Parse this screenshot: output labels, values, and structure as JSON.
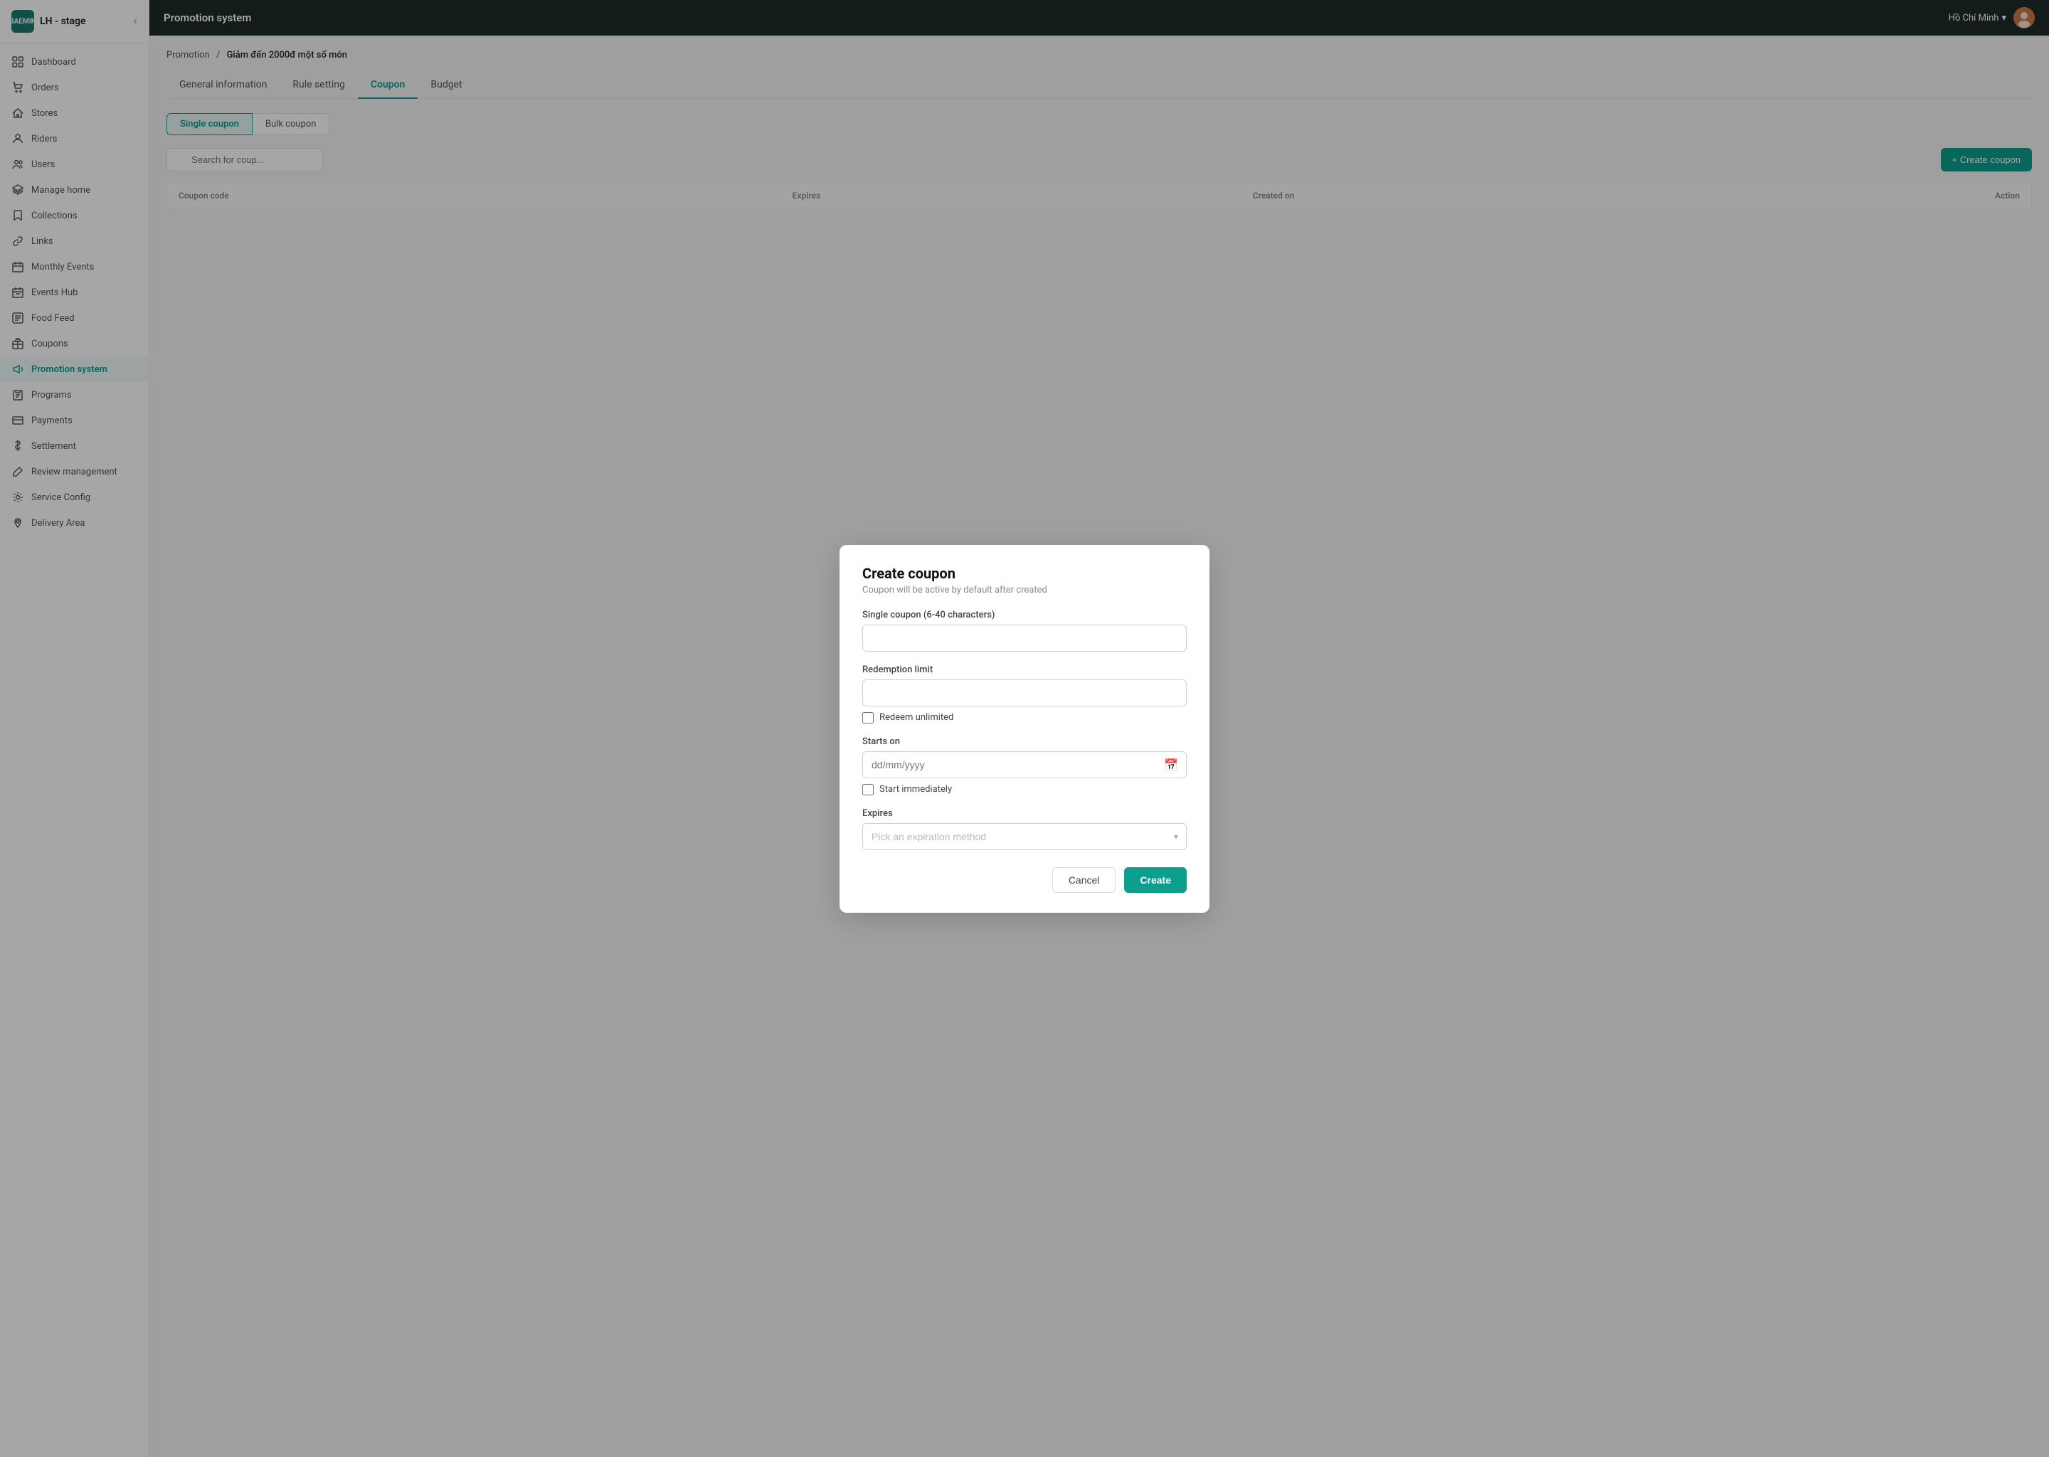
{
  "app": {
    "logo_line1": "BAE",
    "logo_line2": "MIN",
    "title": "LH - stage"
  },
  "topbar": {
    "title": "Promotion system",
    "location": "Hồ Chí Minh",
    "chevron": "▾"
  },
  "sidebar": {
    "items": [
      {
        "id": "dashboard",
        "label": "Dashboard",
        "icon": "grid"
      },
      {
        "id": "orders",
        "label": "Orders",
        "icon": "cart"
      },
      {
        "id": "stores",
        "label": "Stores",
        "icon": "home"
      },
      {
        "id": "riders",
        "label": "Riders",
        "icon": "person"
      },
      {
        "id": "users",
        "label": "Users",
        "icon": "users"
      },
      {
        "id": "manage-home",
        "label": "Manage home",
        "icon": "layers"
      },
      {
        "id": "collections",
        "label": "Collections",
        "icon": "bookmark"
      },
      {
        "id": "links",
        "label": "Links",
        "icon": "link"
      },
      {
        "id": "monthly-events",
        "label": "Monthly Events",
        "icon": "calendar"
      },
      {
        "id": "events-hub",
        "label": "Events Hub",
        "icon": "calendar-alt"
      },
      {
        "id": "food-feed",
        "label": "Food Feed",
        "icon": "feed"
      },
      {
        "id": "coupons",
        "label": "Coupons",
        "icon": "gift"
      },
      {
        "id": "promotion-system",
        "label": "Promotion system",
        "icon": "megaphone",
        "active": true
      },
      {
        "id": "programs",
        "label": "Programs",
        "icon": "clipboard"
      },
      {
        "id": "payments",
        "label": "Payments",
        "icon": "credit-card"
      },
      {
        "id": "settlement",
        "label": "Settlement",
        "icon": "dollar"
      },
      {
        "id": "review-management",
        "label": "Review management",
        "icon": "edit"
      },
      {
        "id": "service-config",
        "label": "Service Config",
        "icon": "settings"
      },
      {
        "id": "delivery-area",
        "label": "Delivery Area",
        "icon": "user-location"
      }
    ]
  },
  "breadcrumb": {
    "parent": "Promotion",
    "separator": "/",
    "current": "Giảm đến 2000đ một số món"
  },
  "tabs": [
    {
      "id": "general",
      "label": "General information"
    },
    {
      "id": "rule",
      "label": "Rule setting"
    },
    {
      "id": "coupon",
      "label": "Coupon",
      "active": true
    },
    {
      "id": "budget",
      "label": "Budget"
    }
  ],
  "sub_tabs": [
    {
      "id": "single",
      "label": "Single coupon",
      "active": true
    },
    {
      "id": "bulk",
      "label": "Bulk coupon"
    }
  ],
  "table": {
    "search_placeholder": "Search for coup...",
    "create_btn": "+ Create coupon",
    "columns": [
      {
        "id": "code",
        "label": "Coupon code"
      },
      {
        "id": "expires",
        "label": "Expires"
      },
      {
        "id": "created_on",
        "label": "Created on"
      },
      {
        "id": "action",
        "label": "Action"
      }
    ]
  },
  "modal": {
    "title": "Create coupon",
    "subtitle": "Coupon will be active by default after created",
    "fields": {
      "coupon_code": {
        "label": "Single coupon (6-40 characters)",
        "placeholder": ""
      },
      "redemption_limit": {
        "label": "Redemption limit",
        "placeholder": ""
      },
      "redeem_unlimited": {
        "label": "Redeem unlimited"
      },
      "starts_on": {
        "label": "Starts on",
        "placeholder": "dd/mm/yyyy"
      },
      "start_immediately": {
        "label": "Start immediately"
      },
      "expires": {
        "label": "Expires",
        "placeholder": "Pick an expiration method"
      }
    },
    "cancel_btn": "Cancel",
    "create_btn": "Create"
  }
}
